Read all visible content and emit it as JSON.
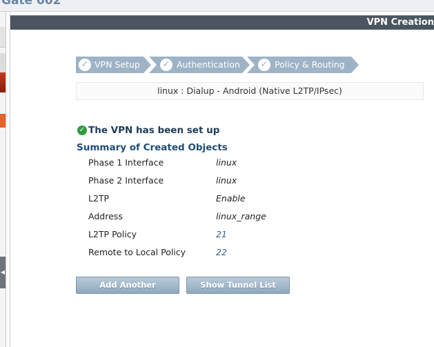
{
  "window": {
    "top_title": "Gate 002"
  },
  "header": {
    "title": "VPN Creation"
  },
  "wizard": {
    "steps": [
      {
        "label": "VPN Setup"
      },
      {
        "label": "Authentication"
      },
      {
        "label": "Policy & Routing"
      }
    ],
    "vpn_name": "linux : Dialup - Android (Native L2TP/IPsec)"
  },
  "result": {
    "status": "The VPN has been set up",
    "summary_title": "Summary of Created Objects",
    "rows": [
      {
        "label": "Phase 1 Interface",
        "value": "linux"
      },
      {
        "label": "Phase 2 Interface",
        "value": "linux"
      },
      {
        "label": "L2TP",
        "value": "Enable"
      },
      {
        "label": "Address",
        "value": "linux_range"
      },
      {
        "label": "L2TP Policy",
        "value": "21"
      },
      {
        "label": "Remote to Local Policy",
        "value": "22"
      }
    ]
  },
  "buttons": {
    "add_another": "Add Another",
    "show_tunnel_list": "Show Tunnel List"
  },
  "colors": {
    "header_bg": "#4b5560",
    "step_bg": "#9eb3c6",
    "success_green": "#2e9b3f",
    "summary_blue": "#1e4e78",
    "link_blue": "#2f5f8f"
  },
  "icons": [
    "check-icon",
    "success-check-icon",
    "collapse-arrow-icon"
  ]
}
